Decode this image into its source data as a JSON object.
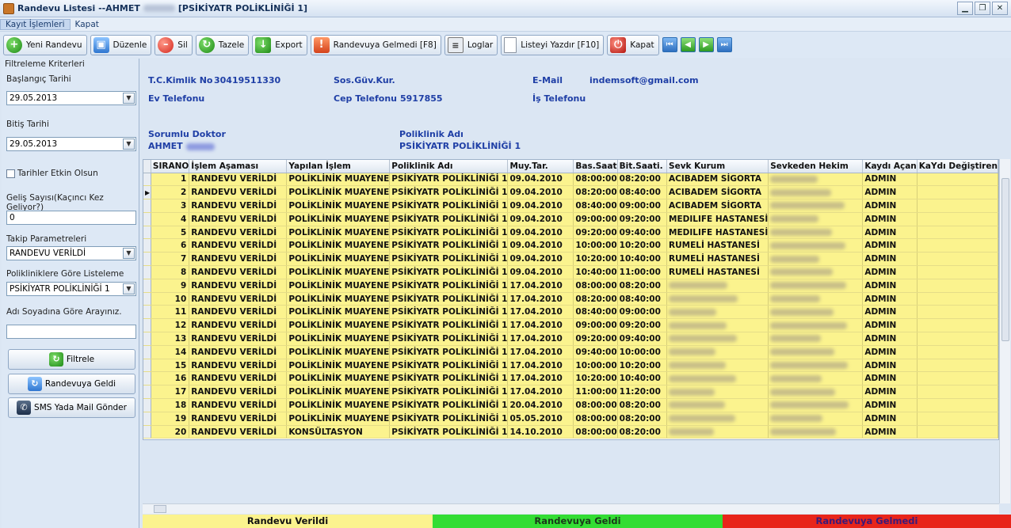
{
  "window": {
    "title_prefix": "Randevu Listesi --AHMET",
    "title_suffix": "[PSİKİYATR POLİKLİNİĞİ 1]",
    "controls": [
      "▁",
      "❐",
      "✕"
    ]
  },
  "menu": [
    "Kayıt İşlemleri",
    "Kapat"
  ],
  "toolbar": {
    "new": "Yeni Randevu",
    "edit": "Düzenle",
    "delete": "Sil",
    "refresh": "Tazele",
    "export": "Export",
    "no_show": "Randevuya Gelmedi  [F8]",
    "logs": "Loglar",
    "print": "Listeyi Yazdır  [F10]",
    "close": "Kapat",
    "nav": [
      "⏮",
      "◀",
      "▶",
      "⏭"
    ]
  },
  "filters": {
    "group_title": "Filtreleme Kriterleri",
    "start_label": "Başlangıç Tarihi",
    "start_value": "29.05.2013",
    "end_label": "Bitiş Tarihi",
    "end_value": "29.05.2013",
    "dates_active_label": "Tarihler Etkin Olsun",
    "visit_count_label": "Geliş Sayısı(Kaçıncı Kez Geliyor?)",
    "visit_count_value": "0",
    "tracking_label": "Takip Parametreleri",
    "tracking_value": "RANDEVU VERİLDİ",
    "clinic_label": "Polikliniklere Göre Listeleme",
    "clinic_value": "PSİKİYATR POLİKLİNİĞİ 1",
    "name_search_label": "Adı Soyadına Göre Arayınız.",
    "name_search_value": "",
    "filter_button": "Filtrele",
    "arrived_button": "Randevuya Geldi",
    "sms_button": "SMS Yada Mail Gönder"
  },
  "patient": {
    "tc_label": "T.C.Kimlik No",
    "tc_value": "30419511330",
    "ssi_label": "Sos.Güv.Kur.",
    "email_label": "E-Mail",
    "email_value": "indemsoft@gmail.com",
    "home_phone_label": "Ev Telefonu",
    "mobile_label": "Cep Telefonu",
    "mobile_value": "5917855",
    "work_phone_label": "İş Telefonu",
    "doctor_label": "Sorumlu Doktor",
    "doctor_value": "AHMET",
    "clinic_label": "Poliklinik Adı",
    "clinic_value": "PSİKİYATR POLİKLİNİĞİ 1"
  },
  "table": {
    "columns": [
      "SIRANO",
      "İşlem Aşaması",
      "Yapılan İşlem",
      "Poliklinik Adı",
      "Muy.Tar.",
      "Bas.Saat",
      "Bit.Saati.",
      "Sevk Kurum",
      "Sevkeden Hekim",
      "Kaydı Açan",
      "KaYdı Değiştiren"
    ],
    "rows": [
      [
        "1",
        "RANDEVU VERİLDİ",
        "POLİKLİNİK MUAYENE",
        "PSİKİYATR POLİKLİNİĞİ 1",
        "09.04.2010",
        "08:00:00",
        "08:20:00",
        "ACIBADEM SİGORTA",
        "",
        "ADMIN",
        ""
      ],
      [
        "2",
        "RANDEVU VERİLDİ",
        "POLİKLİNİK MUAYENE",
        "PSİKİYATR POLİKLİNİĞİ 1",
        "09.04.2010",
        "08:20:00",
        "08:40:00",
        "ACIBADEM SİGORTA",
        "",
        "ADMIN",
        ""
      ],
      [
        "3",
        "RANDEVU VERİLDİ",
        "POLİKLİNİK MUAYENE",
        "PSİKİYATR POLİKLİNİĞİ 1",
        "09.04.2010",
        "08:40:00",
        "09:00:00",
        "ACIBADEM SİGORTA",
        "",
        "ADMIN",
        ""
      ],
      [
        "4",
        "RANDEVU VERİLDİ",
        "POLİKLİNİK MUAYENE",
        "PSİKİYATR POLİKLİNİĞİ 1",
        "09.04.2010",
        "09:00:00",
        "09:20:00",
        "MEDILIFE HASTANESİ",
        "",
        "ADMIN",
        ""
      ],
      [
        "5",
        "RANDEVU VERİLDİ",
        "POLİKLİNİK MUAYENE",
        "PSİKİYATR POLİKLİNİĞİ 1",
        "09.04.2010",
        "09:20:00",
        "09:40:00",
        "MEDILIFE HASTANESİ",
        "",
        "ADMIN",
        ""
      ],
      [
        "6",
        "RANDEVU VERİLDİ",
        "POLİKLİNİK MUAYENE",
        "PSİKİYATR POLİKLİNİĞİ 1",
        "09.04.2010",
        "10:00:00",
        "10:20:00",
        "RUMELİ HASTANESİ",
        "",
        "ADMIN",
        ""
      ],
      [
        "7",
        "RANDEVU VERİLDİ",
        "POLİKLİNİK MUAYENE",
        "PSİKİYATR POLİKLİNİĞİ 1",
        "09.04.2010",
        "10:20:00",
        "10:40:00",
        "RUMELİ HASTANESİ",
        "",
        "ADMIN",
        ""
      ],
      [
        "8",
        "RANDEVU VERİLDİ",
        "POLİKLİNİK MUAYENE",
        "PSİKİYATR POLİKLİNİĞİ 1",
        "09.04.2010",
        "10:40:00",
        "11:00:00",
        "RUMELİ HASTANESİ",
        "",
        "ADMIN",
        ""
      ],
      [
        "9",
        "RANDEVU VERİLDİ",
        "POLİKLİNİK MUAYENE",
        "PSİKİYATR POLİKLİNİĞİ 1",
        "17.04.2010",
        "08:00:00",
        "08:20:00",
        "",
        "",
        "ADMIN",
        ""
      ],
      [
        "10",
        "RANDEVU VERİLDİ",
        "POLİKLİNİK MUAYENE",
        "PSİKİYATR POLİKLİNİĞİ 1",
        "17.04.2010",
        "08:20:00",
        "08:40:00",
        "",
        "",
        "ADMIN",
        ""
      ],
      [
        "11",
        "RANDEVU VERİLDİ",
        "POLİKLİNİK MUAYENE",
        "PSİKİYATR POLİKLİNİĞİ 1",
        "17.04.2010",
        "08:40:00",
        "09:00:00",
        "",
        "",
        "ADMIN",
        ""
      ],
      [
        "12",
        "RANDEVU VERİLDİ",
        "POLİKLİNİK MUAYENE",
        "PSİKİYATR POLİKLİNİĞİ 1",
        "17.04.2010",
        "09:00:00",
        "09:20:00",
        "",
        "",
        "ADMIN",
        ""
      ],
      [
        "13",
        "RANDEVU VERİLDİ",
        "POLİKLİNİK MUAYENE",
        "PSİKİYATR POLİKLİNİĞİ 1",
        "17.04.2010",
        "09:20:00",
        "09:40:00",
        "",
        "",
        "ADMIN",
        ""
      ],
      [
        "14",
        "RANDEVU VERİLDİ",
        "POLİKLİNİK MUAYENE",
        "PSİKİYATR POLİKLİNİĞİ 1",
        "17.04.2010",
        "09:40:00",
        "10:00:00",
        "",
        "",
        "ADMIN",
        ""
      ],
      [
        "15",
        "RANDEVU VERİLDİ",
        "POLİKLİNİK MUAYENE",
        "PSİKİYATR POLİKLİNİĞİ 1",
        "17.04.2010",
        "10:00:00",
        "10:20:00",
        "",
        "",
        "ADMIN",
        ""
      ],
      [
        "16",
        "RANDEVU VERİLDİ",
        "POLİKLİNİK MUAYENE",
        "PSİKİYATR POLİKLİNİĞİ 1",
        "17.04.2010",
        "10:20:00",
        "10:40:00",
        "",
        "",
        "ADMIN",
        ""
      ],
      [
        "17",
        "RANDEVU VERİLDİ",
        "POLİKLİNİK MUAYENE",
        "PSİKİYATR POLİKLİNİĞİ 1",
        "17.04.2010",
        "11:00:00",
        "11:20:00",
        "",
        "",
        "ADMIN",
        ""
      ],
      [
        "18",
        "RANDEVU VERİLDİ",
        "POLİKLİNİK MUAYENE",
        "PSİKİYATR POLİKLİNİĞİ 1",
        "20.04.2010",
        "08:00:00",
        "08:20:00",
        "",
        "",
        "ADMIN",
        ""
      ],
      [
        "19",
        "RANDEVU VERİLDİ",
        "POLİKLİNİK MUAYENE",
        "PSİKİYATR POLİKLİNİĞİ 1",
        "05.05.2010",
        "08:00:00",
        "08:20:00",
        "",
        "",
        "ADMIN",
        ""
      ],
      [
        "20",
        "RANDEVU VERİLDİ",
        "KONSÜLTASYON",
        "PSİKİYATR POLİKLİNİĞİ 1",
        "14.10.2010",
        "08:00:00",
        "08:20:00",
        "",
        "",
        "ADMIN",
        ""
      ]
    ]
  },
  "legend": [
    {
      "label": "Randevu Verildi",
      "color": "#fbf38e",
      "text_color": "#111111"
    },
    {
      "label": "Randevuya Geldi",
      "color": "#33dd33",
      "text_color": "#1a3a1a"
    },
    {
      "label": "Randevuya Gelmedi",
      "color": "#e8251a",
      "text_color": "#3a1a7a"
    }
  ]
}
